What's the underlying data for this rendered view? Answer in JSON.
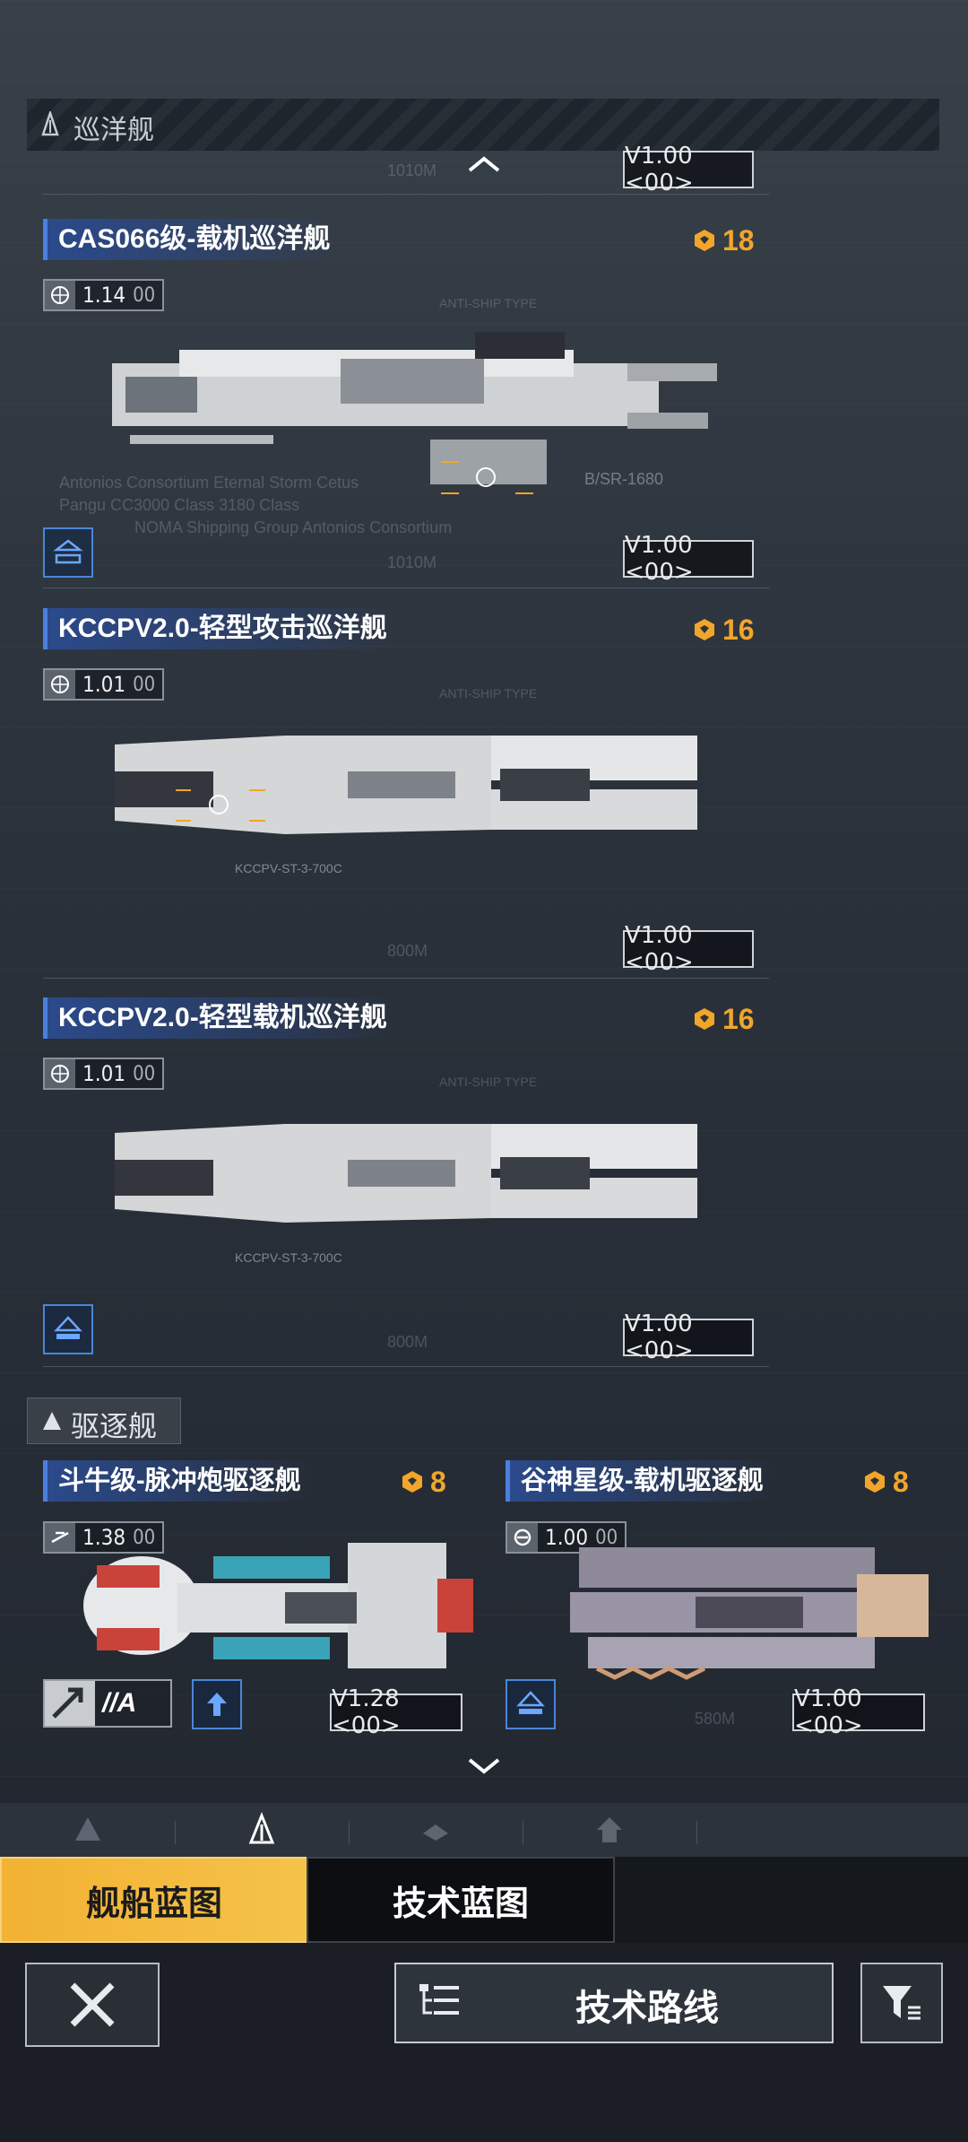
{
  "sections": {
    "cruiser": {
      "title": "巡洋舰"
    },
    "destroyer": {
      "title": "驱逐舰"
    }
  },
  "ships": [
    {
      "title": "CAS066级-载机巡洋舰",
      "cost": "18",
      "version": "1.14",
      "version_suffix": "00",
      "blueprint": "V1.00 <00>",
      "top_blueprint": "V1.00 <00>"
    },
    {
      "title": "KCCPV2.0-轻型攻击巡洋舰",
      "cost": "16",
      "version": "1.01",
      "version_suffix": "00",
      "blueprint": "V1.00 <00>"
    },
    {
      "title": "KCCPV2.0-轻型载机巡洋舰",
      "cost": "16",
      "version": "1.01",
      "version_suffix": "00",
      "blueprint": "V1.00 <00>"
    },
    {
      "title": "斗牛级-脉冲炮驱逐舰",
      "cost": "8",
      "version": "1.38",
      "version_suffix": "00",
      "blueprint": "V1.28 <00>",
      "tag": "//A"
    },
    {
      "title": "谷神星级-载机驱逐舰",
      "cost": "8",
      "version": "1.00",
      "version_suffix": "00",
      "blueprint": "V1.00 <00>"
    }
  ],
  "blueprint_labels": {
    "len_1010": "1010M",
    "len_800": "800M",
    "len_580": "580M",
    "code_kccpv": "KCCPV-ST-3-700C",
    "code_bsr": "B/SR-1680",
    "antiship": "ANTI-SHIP TYPE",
    "faint_1": "Antonios Consortium Eternal Storm Cetus",
    "faint_2": "Pangu CC3000 Class 3180 Class",
    "faint_3": "NOMA Shipping Group Antonios Consortium"
  },
  "tabs": {
    "ships": "舰船蓝图",
    "tech": "技术蓝图"
  },
  "actions": {
    "route": "技术路线"
  },
  "colors": {
    "accent": "#f2b233",
    "title_bg": "#2b4a8c",
    "cost": "#f1a62a"
  },
  "icons": {
    "close": "close-icon",
    "filter": "filter-icon",
    "route": "route-icon"
  }
}
